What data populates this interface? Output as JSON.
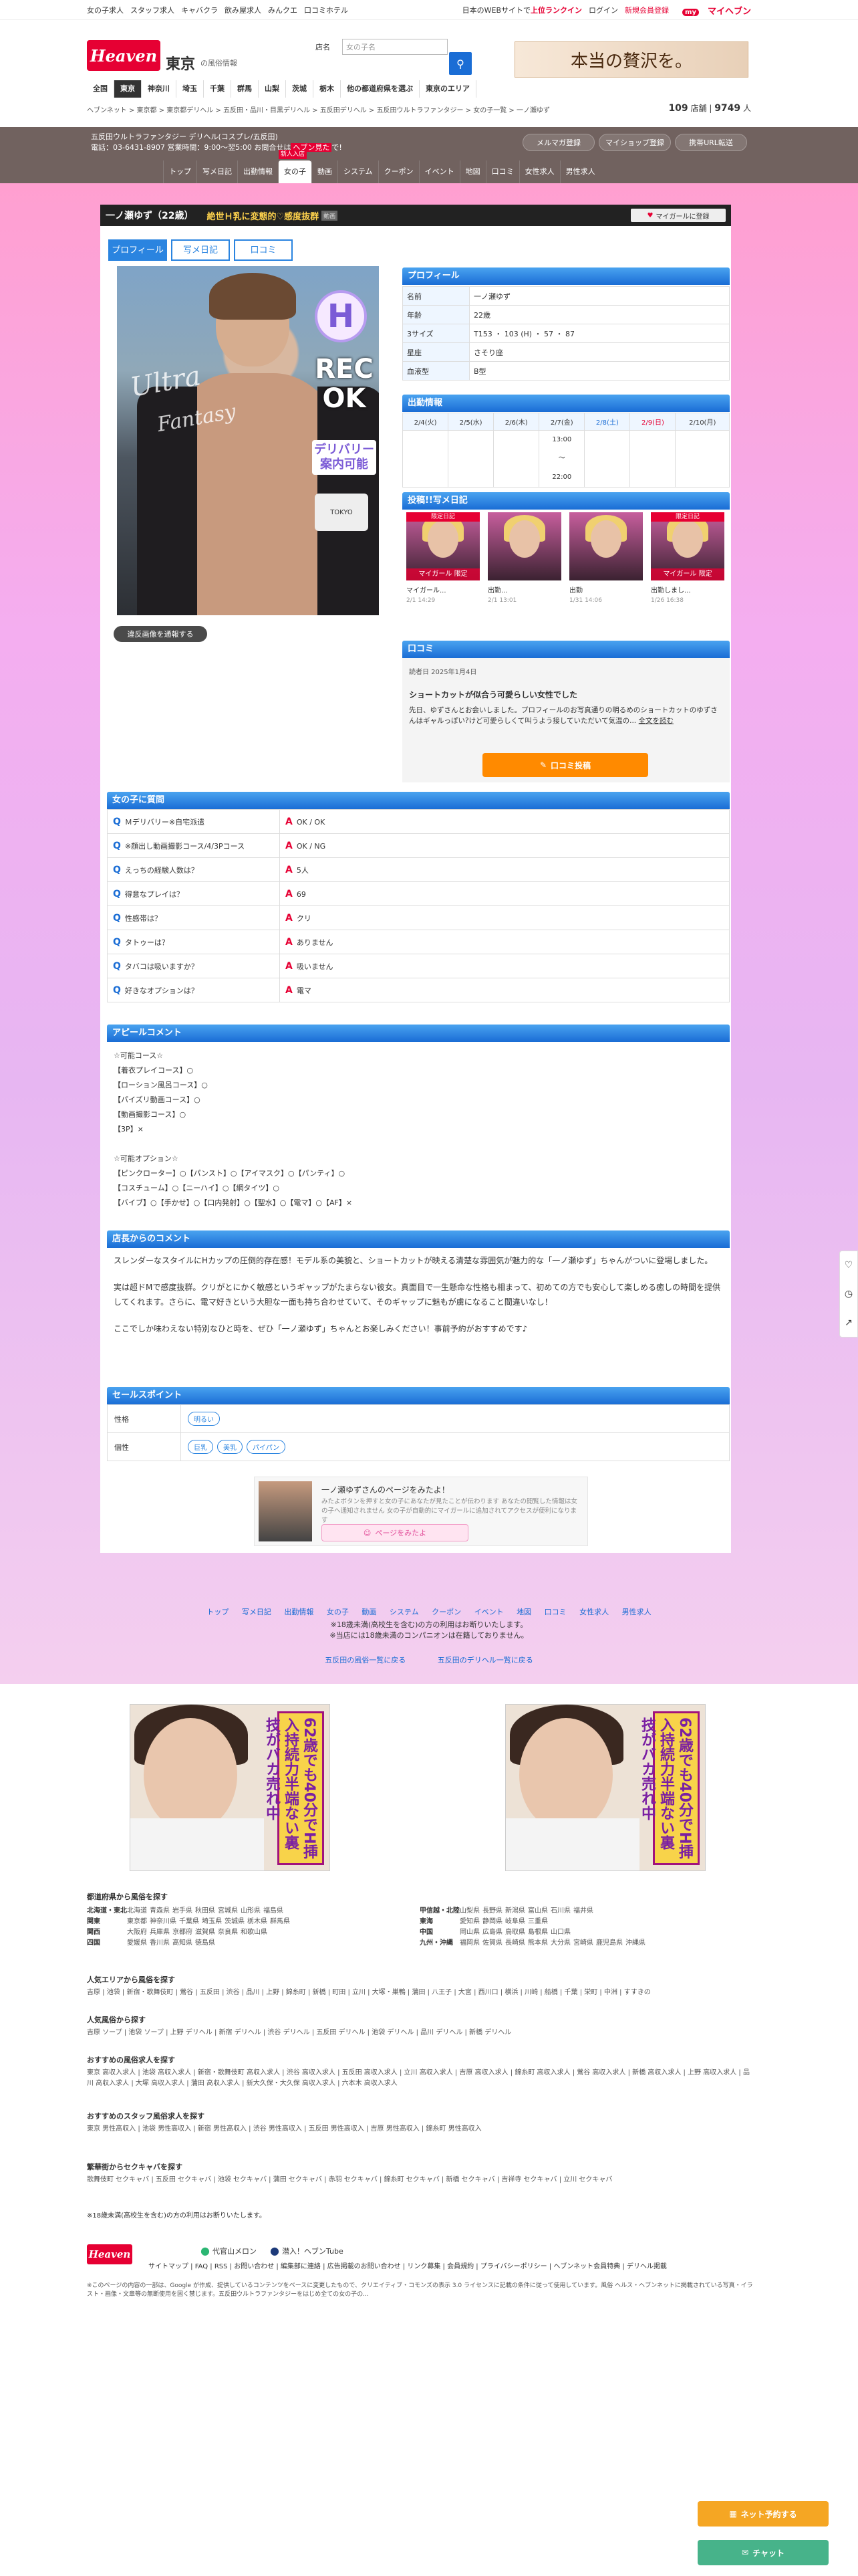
{
  "topbar": {
    "links": [
      "女の子求人",
      "スタッフ求人",
      "キャバクラ",
      "飲み屋求人",
      "みんクエ",
      "口コミホテル"
    ],
    "largest": "日本のWEBサイトで",
    "largest_hl": "上位ランクイン",
    "login": "ログイン",
    "register": "新規会員登録",
    "myheaven": "マイヘブン"
  },
  "header": {
    "logo": "Heaven",
    "area": "東京",
    "area_sub": "の風俗情報",
    "search_label": "店名",
    "search_placeholder": "女の子名",
    "search_icon": "search-icon",
    "banner": "本当の贅沢を。",
    "area_nav": [
      "全国",
      "東京",
      "神奈川",
      "埼玉",
      "千葉",
      "群馬",
      "山梨",
      "茨城",
      "栃木",
      "他の都道府県を選ぶ",
      "東京のエリア"
    ],
    "breadcrumb": "ヘブンネット > 東京都 > 東京都デリヘル > 五反田・品川・目黒デリヘル > 五反田デリヘル > 五反田ウルトラファンタジー > 女の子一覧 > 一ノ瀬ゆず",
    "count_shops": "109",
    "count_shops_unit": "店舗",
    "count_girls": "9749",
    "count_girls_unit": "人"
  },
  "shop": {
    "name": "五反田ウルトラファンタジー デリヘル(コスプレ/五反田)",
    "tel": "電話：03-6431-8907 営業時間：9:00〜翌5:00 お問合せは",
    "tel_hl": "ヘブン見た",
    "tel_end": "で!",
    "buttons": [
      "メルマガ登録",
      "マイショップ登録",
      "携帯URL転送"
    ],
    "nav": [
      "トップ",
      "写メ日記",
      "出勤情報",
      "女の子",
      "動画",
      "システム",
      "クーポン",
      "イベント",
      "地図",
      "口コミ",
      "女性求人",
      "男性求人"
    ],
    "nav_active": "女の子",
    "new_badge": "新人入店"
  },
  "girl": {
    "title_name": "一ノ瀬ゆず（22歳）",
    "catch": "絶世Ｈ乳に変態的♡感度抜群",
    "title_badge": "動画",
    "myhaven_btn": "マイガールに登録",
    "tabs": [
      "プロフィール",
      "写メ日記",
      "口コミ"
    ],
    "photo": {
      "cup": "H",
      "cup_word": "カップ",
      "rec": "REC OK",
      "rec_sub": "動画コース可能",
      "deli": "デリバリー案内可能",
      "logo": "Ultra",
      "logo2": "Fantasy",
      "camera": "TOKYO"
    },
    "report_btn": "違反画像を通報する"
  },
  "profile": {
    "heading": "プロフィール",
    "rows": [
      {
        "k": "名前",
        "v": "一ノ瀬ゆず"
      },
      {
        "k": "年齢",
        "v": "22歳"
      },
      {
        "k": "3サイズ",
        "v": "T153 ・ 103 (H) ・ 57 ・ 87"
      },
      {
        "k": "星座",
        "v": "さそり座"
      },
      {
        "k": "血液型",
        "v": "B型"
      }
    ]
  },
  "schedule": {
    "heading": "出勤情報",
    "days": [
      "2/4(火)",
      "2/5(水)",
      "2/6(木)",
      "2/7(金)",
      "2/8(土)",
      "2/9(日)",
      "2/10(月)"
    ],
    "times": [
      "",
      "",
      "",
      "13:00\n〜\n22:00",
      "",
      "",
      ""
    ]
  },
  "diary": {
    "heading": "投稿!!写メ日記",
    "items": [
      {
        "tag": "限定日記",
        "title": "マイガール...",
        "date": "2/1 14:29",
        "locked": true
      },
      {
        "tag": "",
        "title": "出勤...",
        "date": "2/1 13:01",
        "locked": false
      },
      {
        "tag": "",
        "title": "出勤",
        "date": "1/31 14:06",
        "locked": false
      },
      {
        "tag": "限定日記",
        "title": "出勤しまし...",
        "date": "1/26 16:38",
        "locked": true
      }
    ],
    "mine_label": "マイガール 限定"
  },
  "kuchikomi": {
    "heading": "口コミ",
    "date": "読者日  2025年1月4日",
    "title": "ショートカットが似合う可愛らしい女性でした",
    "body": "先日、ゆずさんとお会いしました。プロフィールのお写真通りの明るめのショートカットのゆずさんはギャルっぽい?けど可愛らしくて叫うよう接していただいて気温の...",
    "more": "全文を読む",
    "post_btn": "口コミ投稿"
  },
  "qa": {
    "heading": "女の子に質問",
    "items": [
      {
        "q": "Ｍデリバリー※自宅派遣",
        "a": "OK / OK"
      },
      {
        "q": "※顔出し動画撮影コース/4/3Pコース",
        "a": "OK / NG"
      },
      {
        "q": "えっちの経験人数は？",
        "a": "5人"
      },
      {
        "q": "得意なプレイは？",
        "a": "69"
      },
      {
        "q": "性感帯は？",
        "a": "クリ"
      },
      {
        "q": "タトゥーは？",
        "a": "ありません"
      },
      {
        "q": "タバコは吸いますか？",
        "a": "吸いません"
      },
      {
        "q": "好きなオプションは？",
        "a": "電マ"
      }
    ]
  },
  "appeal": {
    "heading": "アピールコメント",
    "lines": [
      "☆可能コース☆",
      "【着衣プレイコース】○",
      "【ローション風呂コース】○",
      "【パイズリ動画コース】○",
      "【動画撮影コース】○",
      "【3P】×",
      "",
      "☆可能オプション☆",
      "【ピンクローター】○【パンスト】○【アイマスク】○【パンティ】○",
      "【コスチューム】○【ニーハイ】○【網タイツ】○",
      "【バイブ】○【手かせ】○【口内発射】○【聖水】○【電マ】○【AF】×"
    ]
  },
  "shopcomment": {
    "heading": "店長からのコメント",
    "paras": [
      "スレンダーなスタイルにHカップの圧倒的存在感！モデル系の美貌と、ショートカットが映える清楚な雰囲気が魅力的な「一ノ瀬ゆず」ちゃんがついに登場しました。",
      "実は超ドMで感度抜群。クリがとにかく敏感というギャップがたまらない彼女。真面目で一生懸命な性格も相まって、初めての方でも安心して楽しめる癒しの時間を提供してくれます。さらに、電マ好きという大胆な一面も持ち合わせていて、そのギャップに魅もが虜になること間違いなし！",
      "ここでしか味わえない特別なひと時を、ぜひ「一ノ瀬ゆず」ちゃんとお楽しみください！事前予約がおすすめです♪"
    ]
  },
  "sales": {
    "heading": "セールスポイント",
    "rows": [
      {
        "k": "性格",
        "chips": [
          "明るい"
        ]
      },
      {
        "k": "個性",
        "chips": [
          "巨乳",
          "美乳",
          "パイパン"
        ]
      }
    ]
  },
  "share": {
    "title": "一ノ瀬ゆずさんのページをみたよ！",
    "desc": "みたよボタンを押すと女の子にあなたが見たことが伝わります あなたの閲覧した情報は女の子へ通知されません 女の子が自動的にマイガールに追加されてアクセスが便利になります",
    "btn": "ページをみたよ"
  },
  "bottomnav": {
    "links": [
      "トップ",
      "写メ日記",
      "出勤情報",
      "女の子",
      "動画",
      "システム",
      "クーポン",
      "イベント",
      "地図",
      "口コミ",
      "女性求人",
      "男性求人"
    ],
    "note1": "※18歳未満(高校生を含む)の方の利用はお断りいたします。",
    "note2": "※当店には18歳未満のコンパニオンは在籍しておりません。",
    "links2": [
      "五反田の風俗一覧に戻る",
      "五反田のデリヘル一覧に戻る"
    ]
  },
  "ads": [
    {
      "text": "62歳でも40分でH挿入持続力半端ない裏技がバカ売れ中"
    },
    {
      "text": "62歳でも40分でH挿入持続力半端ない裏技がバカ売れ中"
    }
  ],
  "prefs": {
    "heading": "都道府県から風俗を探す",
    "left": [
      {
        "r": "北海道・東北",
        "p": [
          "北海道",
          "青森県",
          "岩手県",
          "秋田県",
          "宮城県",
          "山形県",
          "福島県"
        ]
      },
      {
        "r": "関東",
        "p": [
          "東京都",
          "神奈川県",
          "千葉県",
          "埼玉県",
          "茨城県",
          "栃木県",
          "群馬県"
        ]
      },
      {
        "r": "関西",
        "p": [
          "大阪府",
          "兵庫県",
          "京都府",
          "滋賀県",
          "奈良県",
          "和歌山県"
        ]
      },
      {
        "r": "四国",
        "p": [
          "愛媛県",
          "香川県",
          "高知県",
          "徳島県"
        ]
      }
    ],
    "right": [
      {
        "r": "甲信越・北陸",
        "p": [
          "山梨県",
          "長野県",
          "新潟県",
          "富山県",
          "石川県",
          "福井県"
        ]
      },
      {
        "r": "東海",
        "p": [
          "愛知県",
          "静岡県",
          "岐阜県",
          "三重県"
        ]
      },
      {
        "r": "中国",
        "p": [
          "岡山県",
          "広島県",
          "鳥取県",
          "島根県",
          "山口県"
        ]
      },
      {
        "r": "九州・沖縄",
        "p": [
          "福岡県",
          "佐賀県",
          "長崎県",
          "熊本県",
          "大分県",
          "宮崎県",
          "鹿児島県",
          "沖縄県"
        ]
      }
    ]
  },
  "linksections": [
    {
      "h": "人気エリアから風俗を探す",
      "t": "吉原 | 池袋 | 新宿・歌舞伎町 | 鶯谷 | 五反田 | 渋谷 | 品川 | 上野 | 錦糸町 | 新橋 | 町田 | 立川 | 大塚・巣鴨 | 蒲田 | 八王子 | 大宮 | 西川口 | 横浜 | 川崎 | 船橋 | 千葉 | 栄町 | 中洲 | すすきの"
    },
    {
      "h": "人気風俗から探す",
      "t": "吉原 ソープ | 池袋 ソープ | 上野 デリヘル | 新宿 デリヘル | 渋谷 デリヘル | 五反田 デリヘル | 池袋 デリヘル | 品川 デリヘル | 新橋 デリヘル"
    },
    {
      "h": "おすすめの風俗求人を探す",
      "t": "東京 高収入求人 | 池袋 高収入求人 | 新宿・歌舞伎町 高収入求人 | 渋谷 高収入求人 | 五反田 高収入求人 | 立川 高収入求人 | 吉原 高収入求人 | 錦糸町 高収入求人 | 鶯谷 高収入求人 | 新橋 高収入求人 | 上野 高収入求人 | 品川 高収入求人 | 大塚 高収入求人 | 蒲田 高収入求人 | 新大久保・大久保 高収入求人 | 六本木 高収入求人"
    },
    {
      "h": "おすすめのスタッフ風俗求人を探す",
      "t": "東京 男性高収入 | 池袋 男性高収入 | 新宿 男性高収入 | 渋谷 男性高収入 | 五反田 男性高収入 | 吉原 男性高収入 | 錦糸町 男性高収入"
    },
    {
      "h": "繁華街からセクキャバを探す",
      "t": "歌舞伎町 セクキャバ | 五反田 セクキャバ | 池袋 セクキャバ | 蒲田 セクキャバ | 赤羽 セクキャバ | 錦糸町 セクキャバ | 新橋 セクキャバ | 吉祥寺 セクキャバ | 立川 セクキャバ"
    }
  ],
  "footer": {
    "note18": "※18歳未満(高校生を含む)の方の利用はお断りいたします。",
    "logo": "Heaven",
    "apps": [
      "代官山メロン",
      "潜入！ヘブンTube"
    ],
    "links": "サイトマップ | FAQ | RSS | お問い合わせ | 編集部に連絡 | 広告掲載のお問い合わせ | リンク募集 | 会員規約 | プライバシーポリシー | ヘブンネット会員特典 | デリヘル掲載",
    "copy": "※このページの内容の一部は、Google が作成、提供しているコンテンツをベースに変更したもので、クリエイティブ・コモンズの表示 3.0 ライセンスに記載の条件に従って使用しています。風俗 ヘルス・ヘブンネットに掲載されている写真・イラスト・画像・文章等の無断使用を固く禁じます。五反田ウルトラファンタジーをはじめ全ての女の子の..."
  },
  "float": {
    "netbtn": "ネット予約する",
    "chatbtn": "チャット"
  }
}
